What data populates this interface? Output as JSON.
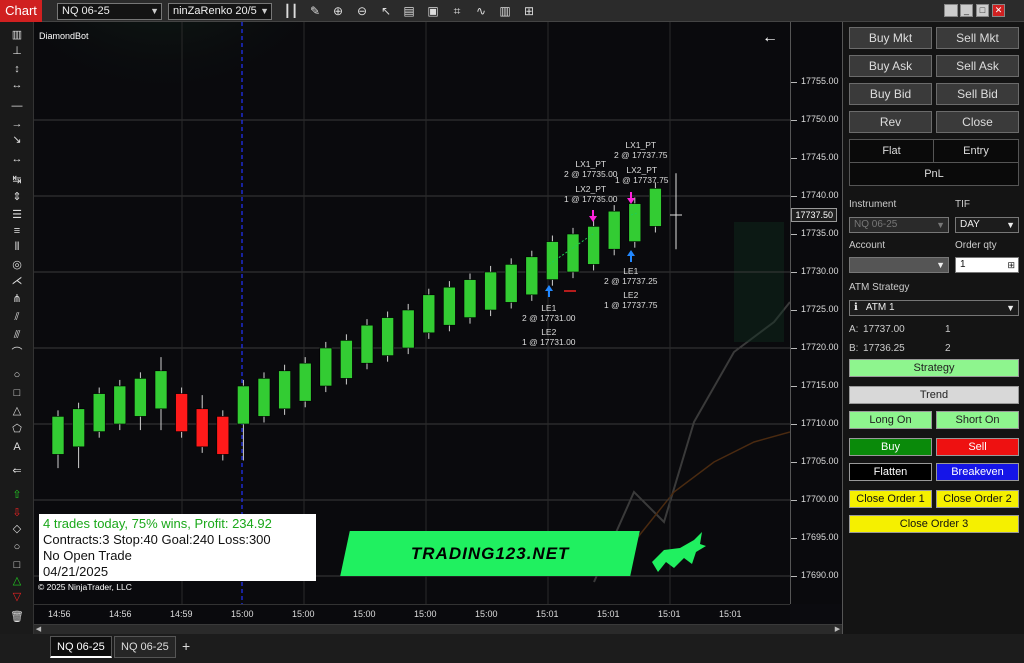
{
  "toolbar": {
    "chart_tab": "Chart",
    "instrument": "NQ 06-25",
    "bar_type": "ninZaRenko 20/5"
  },
  "chart": {
    "strategy_name": "DiamondBot",
    "flag_button": "F",
    "copyright": "© 2025 NinjaTrader, LLC",
    "current_price": "17737.50",
    "y_labels": [
      "17755.00",
      "17750.00",
      "17745.00",
      "17740.00",
      "17735.00",
      "17730.00",
      "17725.00",
      "17720.00",
      "17715.00",
      "17710.00",
      "17705.00",
      "17700.00",
      "17695.00",
      "17690.00"
    ],
    "x_labels": [
      "14:56",
      "14:56",
      "14:59",
      "15:00",
      "15:00",
      "15:00",
      "15:00",
      "15:00",
      "15:01",
      "15:01",
      "15:01",
      "15:01",
      "15:01"
    ],
    "trades": {
      "le1": "LE1",
      "le1_fill": "2 @ 17731.00",
      "le2": "LE2",
      "le2_fill": "1 @ 17731.00",
      "lx1_pt_a": "LX1_PT",
      "lx1_pt_a_fill": "2 @ 17735.00",
      "lx2_pt_a": "LX2_PT",
      "lx2_pt_a_fill": "1 @ 17735.00",
      "lx1_pt_b": "LX1_PT",
      "lx1_pt_b_fill": "2 @ 17737.75",
      "lx2_pt_b": "LX2_PT",
      "lx2_pt_b_fill": "1 @ 17737.75",
      "le1_b": "LE1",
      "le1_b_fill": "2 @ 17737.25",
      "le2_b": "LE2",
      "le2_b_fill": "1 @ 17737.75"
    },
    "info": {
      "line1": "4 trades today, 75% wins, Profit: 234.92",
      "line2": "Contracts:3 Stop:40 Goal:240 Loss:300",
      "line3": "No Open Trade",
      "line4": "04/21/2025"
    },
    "banner": "TRADING123.NET",
    "candles": [
      {
        "o": 17706,
        "c": 17711,
        "h": 17711,
        "l": 17705,
        "color": "up"
      },
      {
        "o": 17707,
        "c": 17712,
        "h": 17712,
        "l": 17705,
        "color": "up"
      },
      {
        "o": 17709,
        "c": 17714,
        "h": 17714,
        "l": 17709,
        "color": "up"
      },
      {
        "o": 17710,
        "c": 17715,
        "h": 17715,
        "l": 17710,
        "color": "up"
      },
      {
        "o": 17711,
        "c": 17716,
        "h": 17716,
        "l": 17710,
        "color": "up"
      },
      {
        "o": 17712,
        "c": 17717,
        "h": 17718,
        "l": 17710,
        "color": "up"
      },
      {
        "o": 17714,
        "c": 17709,
        "h": 17714,
        "l": 17709,
        "color": "down"
      },
      {
        "o": 17712,
        "c": 17707,
        "h": 17713,
        "l": 17707,
        "color": "down"
      },
      {
        "o": 17711,
        "c": 17706,
        "h": 17711,
        "l": 17706,
        "color": "down"
      },
      {
        "o": 17710,
        "c": 17715,
        "h": 17715,
        "l": 17706,
        "color": "up"
      },
      {
        "o": 17711,
        "c": 17716,
        "h": 17716,
        "l": 17711,
        "color": "up"
      },
      {
        "o": 17712,
        "c": 17717,
        "h": 17717,
        "l": 17712,
        "color": "up"
      },
      {
        "o": 17713,
        "c": 17718,
        "h": 17718,
        "l": 17713,
        "color": "up"
      },
      {
        "o": 17715,
        "c": 17720,
        "h": 17720,
        "l": 17715,
        "color": "up"
      },
      {
        "o": 17716,
        "c": 17721,
        "h": 17721,
        "l": 17716,
        "color": "up"
      },
      {
        "o": 17718,
        "c": 17723,
        "h": 17723,
        "l": 17718,
        "color": "up"
      },
      {
        "o": 17719,
        "c": 17724,
        "h": 17724,
        "l": 17719,
        "color": "up"
      },
      {
        "o": 17720,
        "c": 17725,
        "h": 17725,
        "l": 17720,
        "color": "up"
      },
      {
        "o": 17722,
        "c": 17727,
        "h": 17727,
        "l": 17722,
        "color": "up"
      },
      {
        "o": 17723,
        "c": 17728,
        "h": 17728,
        "l": 17723,
        "color": "up"
      },
      {
        "o": 17724,
        "c": 17729,
        "h": 17729,
        "l": 17724,
        "color": "up"
      },
      {
        "o": 17725,
        "c": 17730,
        "h": 17730,
        "l": 17725,
        "color": "up"
      },
      {
        "o": 17726,
        "c": 17731,
        "h": 17731,
        "l": 17726,
        "color": "up"
      },
      {
        "o": 17727,
        "c": 17732,
        "h": 17732,
        "l": 17727,
        "color": "up"
      },
      {
        "o": 17729,
        "c": 17734,
        "h": 17734,
        "l": 17729,
        "color": "up"
      },
      {
        "o": 17730,
        "c": 17735,
        "h": 17735,
        "l": 17730,
        "color": "up"
      },
      {
        "o": 17731,
        "c": 17736,
        "h": 17736,
        "l": 17731,
        "color": "up"
      },
      {
        "o": 17733,
        "c": 17738,
        "h": 17738,
        "l": 17733,
        "color": "up"
      },
      {
        "o": 17734,
        "c": 17739,
        "h": 17739,
        "l": 17734,
        "color": "up"
      },
      {
        "o": 17736,
        "c": 17741,
        "h": 17741,
        "l": 17736,
        "color": "up"
      }
    ],
    "colors": {
      "up": "#33cc33",
      "down": "#ff1a1a",
      "entry_arrow": "#2288ff",
      "exit_arrow": "#ff22dd",
      "cursor_line": "#2233ff"
    }
  },
  "bottom_tabs": [
    "NQ 06-25",
    "NQ 06-25",
    "+"
  ],
  "panel": {
    "buy_mkt": "Buy Mkt",
    "sell_mkt": "Sell Mkt",
    "buy_ask": "Buy Ask",
    "sell_ask": "Sell Ask",
    "buy_bid": "Buy Bid",
    "sell_bid": "Sell Bid",
    "rev": "Rev",
    "close": "Close",
    "flat": "Flat",
    "entry": "Entry",
    "pnl": "PnL",
    "instrument_label": "Instrument",
    "instrument_value": "NQ 06-25",
    "tif_label": "TIF",
    "tif_value": "DAY",
    "account_label": "Account",
    "order_qty_label": "Order qty",
    "order_qty_value": "1",
    "atm_label": "ATM Strategy",
    "atm_value": "ATM 1",
    "a_label": "A:",
    "a_price": "17737.00",
    "a_qty": "1",
    "b_label": "B:",
    "b_price": "17736.25",
    "b_qty": "2",
    "strategy": "Strategy",
    "trend": "Trend",
    "long_on": "Long On",
    "short_on": "Short On",
    "buy": "Buy",
    "sell": "Sell",
    "flatten": "Flatten",
    "breakeven": "Breakeven",
    "close_order_1": "Close Order 1",
    "close_order_2": "Close Order 2",
    "close_order_3": "Close Order 3"
  }
}
